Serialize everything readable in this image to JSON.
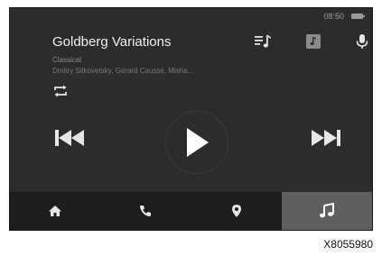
{
  "status": {
    "time": "08:50"
  },
  "track": {
    "title": "Goldberg Variations",
    "genre": "Classical",
    "artists": "Dmitry Sitkovetsky, Gerard Caussé, Misha..."
  },
  "icons": {
    "queue": "playlist-icon",
    "source": "media-source-icon",
    "voice": "microphone-icon",
    "repeat": "repeat-icon",
    "previous": "skip-previous-icon",
    "play": "play-icon",
    "next": "skip-next-icon"
  },
  "nav": {
    "items": [
      {
        "id": "home",
        "icon": "home-icon",
        "active": false
      },
      {
        "id": "phone",
        "icon": "phone-icon",
        "active": false
      },
      {
        "id": "navigation",
        "icon": "map-pin-icon",
        "active": false
      },
      {
        "id": "media",
        "icon": "music-note-icon",
        "active": true
      }
    ]
  },
  "colors": {
    "screen_background": "#2c2c2c",
    "navbar_background": "#1d1d1d",
    "active_tab": "#5f5f5f",
    "text_primary": "#f0f0f0",
    "text_secondary": "#8a8a8a"
  },
  "figure_code": "X8055980"
}
